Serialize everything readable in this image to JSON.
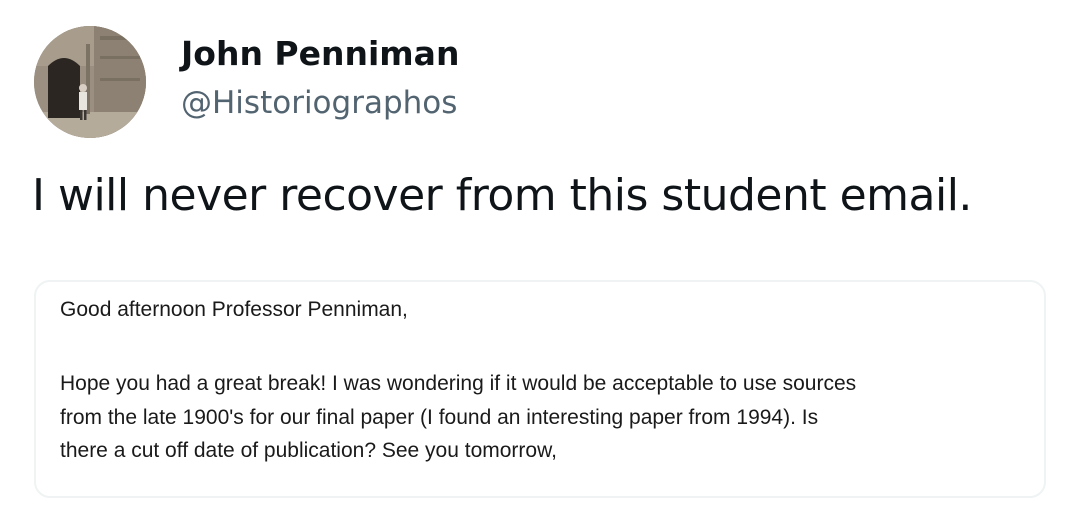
{
  "tweet": {
    "author": {
      "display_name": "John Penniman",
      "handle": "@Historiographos",
      "avatar_icon": "profile-photo-stone-doorway"
    },
    "text": "I will never recover from this student email.",
    "email_screenshot": {
      "greeting": "Good afternoon Professor Penniman,",
      "body_lines": [
        "Hope you had a great break! I was wondering if it would be acceptable to use sources",
        "from the late 1900's for our final paper (I found an interesting paper from 1994). Is",
        "there a cut off date of publication? See you tomorrow,"
      ]
    }
  },
  "colors": {
    "text_primary": "#0f1419",
    "text_secondary": "#536471",
    "card_border": "#eff3f4"
  }
}
